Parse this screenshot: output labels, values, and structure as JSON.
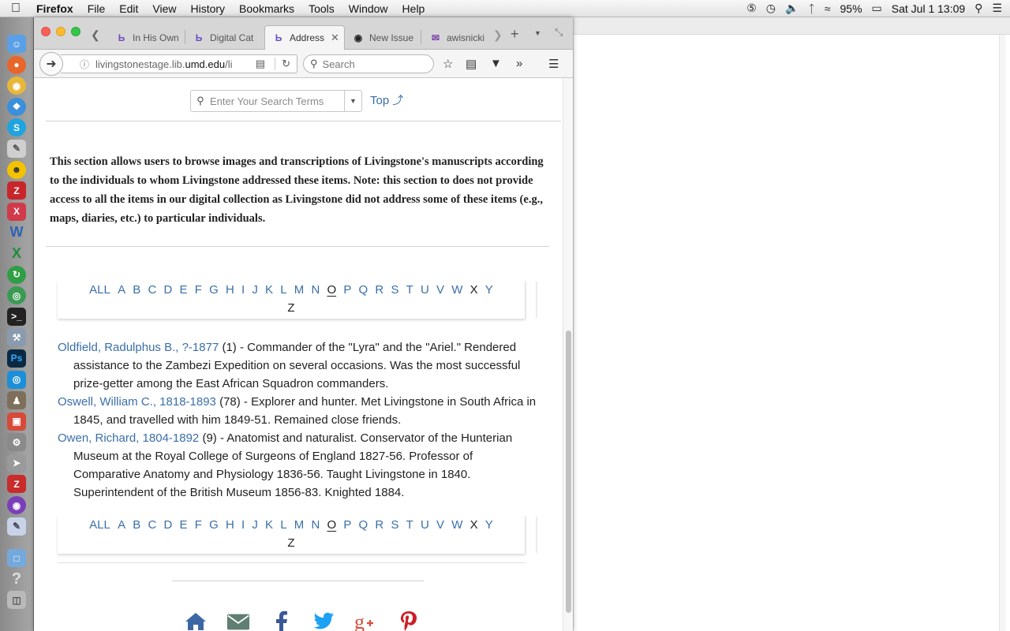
{
  "menubar": {
    "app_name": "Firefox",
    "items": [
      "File",
      "Edit",
      "View",
      "History",
      "Bookmarks",
      "Tools",
      "Window",
      "Help"
    ],
    "battery": "95%",
    "datetime": "Sat Jul 1  13:09"
  },
  "tabs": [
    {
      "label": "In His Own"
    },
    {
      "label": "Digital Cat"
    },
    {
      "label": "Address"
    },
    {
      "label": "New Issue"
    },
    {
      "label": "awisnicki"
    }
  ],
  "navbar": {
    "url_prefix": "livingstonestage.lib.",
    "url_domain": "umd.edu",
    "url_suffix": "/li",
    "search_placeholder": "Search"
  },
  "page": {
    "search_placeholder": "Enter Your Search Terms",
    "top_link": "Top",
    "intro": "This section allows users to browse images and transcriptions of Livingstone's manuscripts according to the individuals to whom Livingstone addressed these items. Note: this section to does not provide access to all the items in our digital collection as Livingstone did not address some of these items (e.g., maps, diaries, etc.) to particular individuals.",
    "alphabet": [
      "ALL",
      "A",
      "B",
      "C",
      "D",
      "E",
      "F",
      "G",
      "H",
      "I",
      "J",
      "K",
      "L",
      "M",
      "N",
      "O",
      "P",
      "Q",
      "R",
      "S",
      "T",
      "U",
      "V",
      "W",
      "X",
      "Y",
      "Z"
    ],
    "current_letter": "O",
    "entries": [
      {
        "name": "Oldfield, Radulphus B., ?-1877",
        "count": "(1)",
        "desc": " - Commander of the \"Lyra\" and the \"Ariel.\" Rendered assistance to the Zambezi Expedition on several occasions. Was the most successful prize-getter among the East African Squadron commanders."
      },
      {
        "name": "Oswell, William C., 1818-1893",
        "count": "(78)",
        "desc": " - Explorer and hunter. Met Livingstone in South Africa in 1845, and travelled with him 1849-51. Remained close friends."
      },
      {
        "name": "Owen, Richard, 1804-1892",
        "count": "(9)",
        "desc": " - Anatomist and naturalist. Conservator of the Hunterian Museum at the Royal College of Surgeons of England 1827-56. Professor of Comparative Anatomy and Physiology 1836-56. Taught Livingstone in 1840. Superintendent of the British Museum 1856-83. Knighted 1884."
      }
    ]
  },
  "colors": {
    "link": "#3a6fa8",
    "home": "#3b68a5",
    "email": "#5f7f72",
    "facebook": "#3b5998",
    "twitter": "#1da1f2",
    "googleplus": "#dd4b39",
    "pinterest": "#cb2027"
  },
  "icons": [
    "home-icon",
    "email-icon",
    "facebook-icon",
    "twitter-icon",
    "google-plus-icon",
    "pinterest-icon"
  ]
}
